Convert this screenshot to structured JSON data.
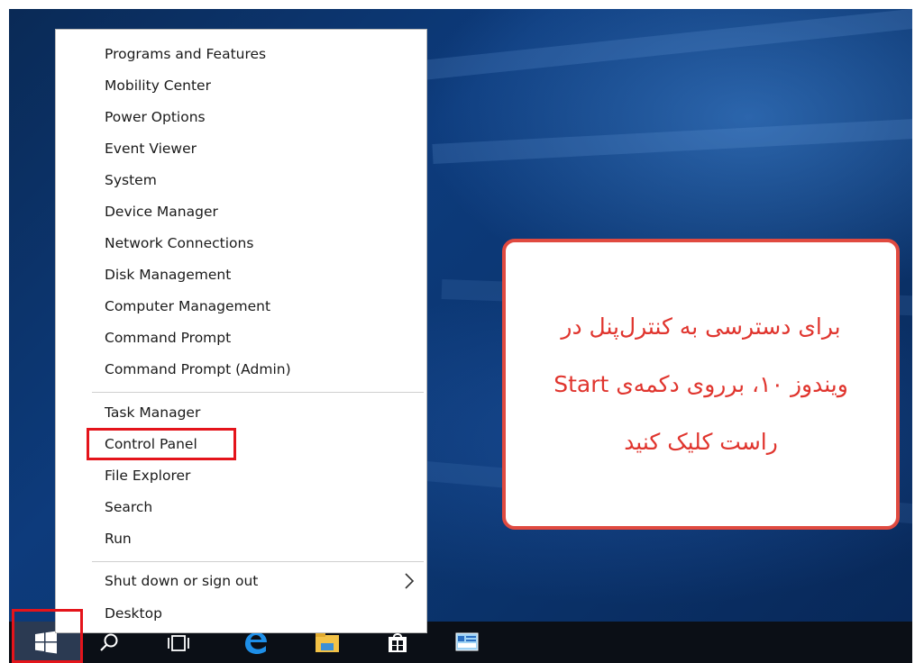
{
  "menu": {
    "items": [
      "Programs and Features",
      "Mobility Center",
      "Power Options",
      "Event Viewer",
      "System",
      "Device Manager",
      "Network Connections",
      "Disk Management",
      "Computer Management",
      "Command Prompt",
      "Command Prompt (Admin)",
      "Task Manager",
      "Control Panel",
      "File Explorer",
      "Search",
      "Run",
      "Shut down or sign out",
      "Desktop"
    ],
    "highlighted_item": "Control Panel",
    "submenu_icon": "chevron-right-icon"
  },
  "callout": {
    "lines": [
      "برای دسترسی به کنترل‌پنل در",
      "ویندوز ۱۰، برروی دکمه‌ی Start",
      "راست کلیک کنید"
    ]
  },
  "taskbar": {
    "icons": [
      "windows-start-icon",
      "search-icon",
      "task-view-icon",
      "edge-icon",
      "file-explorer-icon",
      "store-icon",
      "control-panel-icon"
    ]
  },
  "colors": {
    "highlight": "#e4141b",
    "callout_text": "#e0352e",
    "desktop": "#0d3b7c",
    "taskbar": "#0b0f16"
  }
}
